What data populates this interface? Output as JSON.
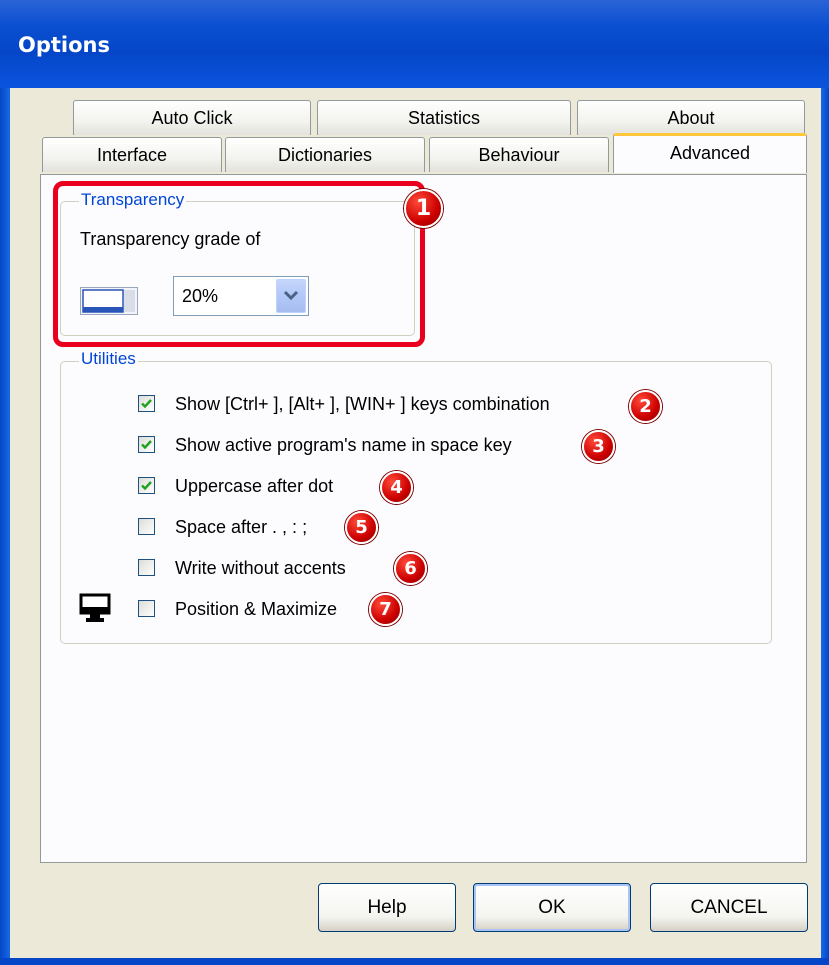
{
  "window": {
    "title": "Options"
  },
  "tabs": {
    "row1": [
      {
        "label": "Auto Click"
      },
      {
        "label": "Statistics"
      },
      {
        "label": "About"
      }
    ],
    "row2": [
      {
        "label": "Interface"
      },
      {
        "label": "Dictionaries"
      },
      {
        "label": "Behaviour"
      },
      {
        "label": "Advanced"
      }
    ]
  },
  "transparency": {
    "group_title": "Transparency",
    "label": "Transparency grade of",
    "value": "20%"
  },
  "utilities": {
    "group_title": "Utilities",
    "options": [
      {
        "label": "Show [Ctrl+ ], [Alt+ ], [WIN+ ] keys combination",
        "checked": true
      },
      {
        "label": "Show active program's name in space key",
        "checked": true
      },
      {
        "label": "Uppercase after dot",
        "checked": true
      },
      {
        "label": "Space after . , : ;",
        "checked": false
      },
      {
        "label": "Write without accents",
        "checked": false
      },
      {
        "label": "Position & Maximize",
        "checked": false
      }
    ]
  },
  "callouts": [
    "1",
    "2",
    "3",
    "4",
    "5",
    "6",
    "7"
  ],
  "buttons": {
    "help": "Help",
    "ok": "OK",
    "cancel": "CANCEL"
  },
  "colors": {
    "highlight": "#e8001e",
    "group_title": "#0046d5",
    "titlebar": "#0a4fd1",
    "callout": "#cc0000"
  }
}
